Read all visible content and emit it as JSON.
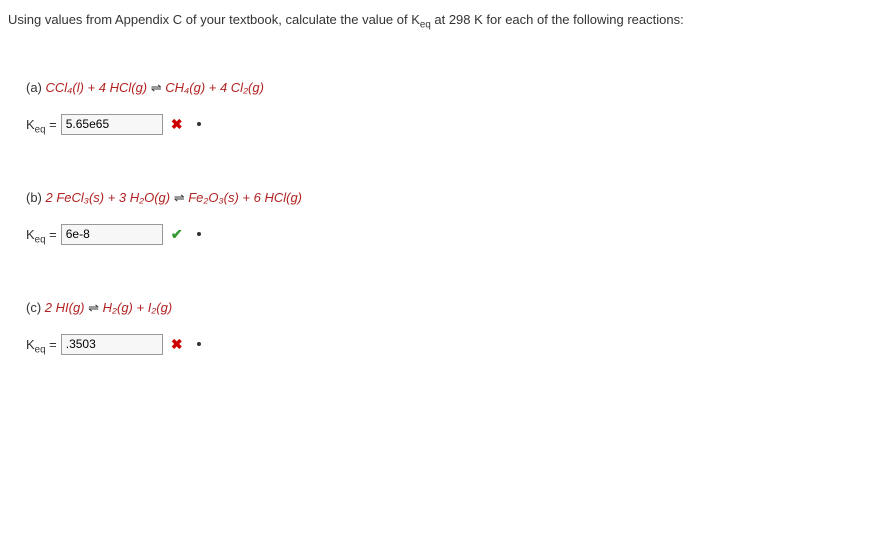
{
  "prompt": {
    "before": "Using values from Appendix C of your textbook, calculate the value of K",
    "sub": "eq",
    "after": " at 298 K for each of the following reactions:"
  },
  "parts": {
    "a": {
      "label": "(a) ",
      "lhs": "CCl₄(l) + 4 HCl(g)",
      "arrow": " ⇌ ",
      "rhs": "CH₄(g) + 4 Cl₂(g)",
      "keq_prefix": "K",
      "keq_sub": "eq",
      "equals": " = ",
      "value": "5.65e65",
      "correct": false
    },
    "b": {
      "label": "(b) ",
      "lhs": "2 FeCl₃(s) + 3 H₂O(g)",
      "arrow": " ⇌ ",
      "rhs": "Fe₂O₃(s) + 6 HCl(g)",
      "keq_prefix": "K",
      "keq_sub": "eq",
      "equals": " = ",
      "value": "6e-8",
      "correct": true
    },
    "c": {
      "label": "(c) ",
      "lhs": "2 HI(g)",
      "arrow": " ⇌ ",
      "rhs": "H₂(g) + I₂(g)",
      "keq_prefix": "K",
      "keq_sub": "eq",
      "equals": " = ",
      "value": ".3503",
      "correct": false
    }
  },
  "icons": {
    "correct": "✔",
    "incorrect": "✖"
  }
}
